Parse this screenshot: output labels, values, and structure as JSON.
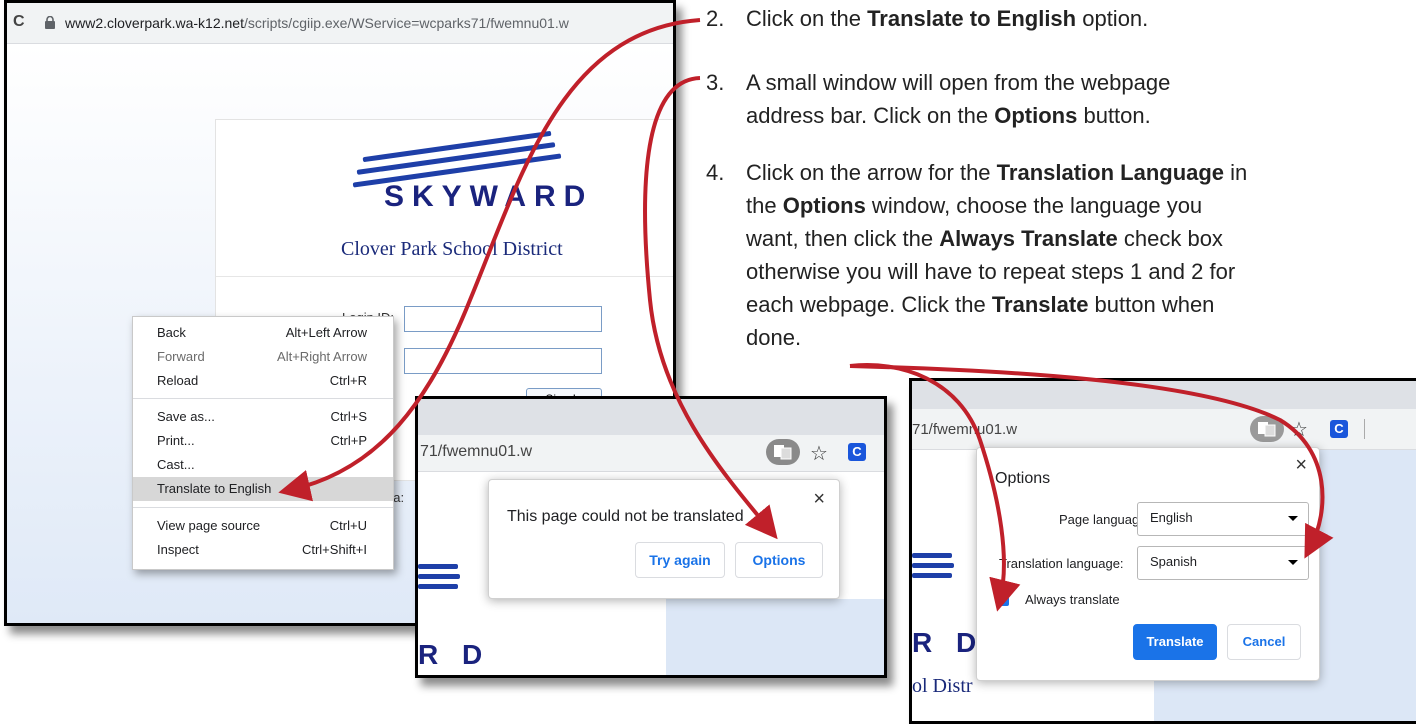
{
  "browser": {
    "url_host": "www2.cloverpark.wa-k12.net",
    "url_path": "/scripts/cgiip.exe/WService=wcparks71/fwemnu01.w",
    "url_tail": "71/fwemnu01.w",
    "url_tail_short": "71/fwemnu01.w",
    "reload_icon": "C"
  },
  "login_page": {
    "logo_text": "SKYWARD",
    "district": "Clover Park School District",
    "login_label": "Login ID:",
    "area_label": "ea:",
    "sign_in": "Sign In"
  },
  "context_menu": {
    "items": [
      {
        "label": "Back",
        "shortcut": "Alt+Left Arrow"
      },
      {
        "label": "Forward",
        "shortcut": "Alt+Right Arrow"
      },
      {
        "label": "Reload",
        "shortcut": "Ctrl+R"
      },
      {
        "label": "Save as...",
        "shortcut": "Ctrl+S"
      },
      {
        "label": "Print...",
        "shortcut": "Ctrl+P"
      },
      {
        "label": "Cast...",
        "shortcut": ""
      },
      {
        "label": "Translate to English",
        "shortcut": ""
      },
      {
        "label": "View page source",
        "shortcut": "Ctrl+U"
      },
      {
        "label": "Inspect",
        "shortcut": "Ctrl+Shift+I"
      }
    ]
  },
  "translate_popup": {
    "message": "This page could not be translated",
    "try_again": "Try again",
    "options": "Options",
    "close": "×"
  },
  "options_dialog": {
    "title": "Options",
    "page_language_label": "Page language:",
    "page_language_value": "English",
    "translation_language_label": "Translation language:",
    "translation_language_value": "Spanish",
    "always_translate_label": "Always translate",
    "always_translate_checked": true,
    "translate_button": "Translate",
    "cancel_button": "Cancel",
    "close": "×",
    "logo_partial": "R D",
    "district_partial": "ol Distr",
    "ext_icon": "C"
  },
  "snippet2": {
    "logo_partial": "R D"
  },
  "instructions": [
    {
      "num": "2.",
      "lines": [
        [
          {
            "t": "Click on the "
          },
          {
            "t": "Translate to English",
            "b": true
          },
          {
            "t": " option."
          }
        ]
      ]
    },
    {
      "num": "3.",
      "lines": [
        [
          {
            "t": "A small window will open from the webpage"
          }
        ],
        [
          {
            "t": "address bar. Click on the "
          },
          {
            "t": "Options",
            "b": true
          },
          {
            "t": " button."
          }
        ]
      ]
    },
    {
      "num": "4.",
      "lines": [
        [
          {
            "t": "Click on the arrow for the "
          },
          {
            "t": "Translation Language",
            "b": true
          },
          {
            "t": " in"
          }
        ],
        [
          {
            "t": "the "
          },
          {
            "t": "Options",
            "b": true
          },
          {
            "t": " window, choose the language you"
          }
        ],
        [
          {
            "t": "want, then click the "
          },
          {
            "t": "Always Translate",
            "b": true
          },
          {
            "t": " check box"
          }
        ],
        [
          {
            "t": "otherwise you will have to repeat steps 1 and 2 for"
          }
        ],
        [
          {
            "t": "each webpage. Click the "
          },
          {
            "t": "Translate",
            "b": true
          },
          {
            "t": " button when"
          }
        ],
        [
          {
            "t": "done."
          }
        ]
      ]
    }
  ],
  "colors": {
    "arrow": "#c0202a",
    "accent_blue": "#1a73e8",
    "skyward_navy": "#1a237e"
  }
}
